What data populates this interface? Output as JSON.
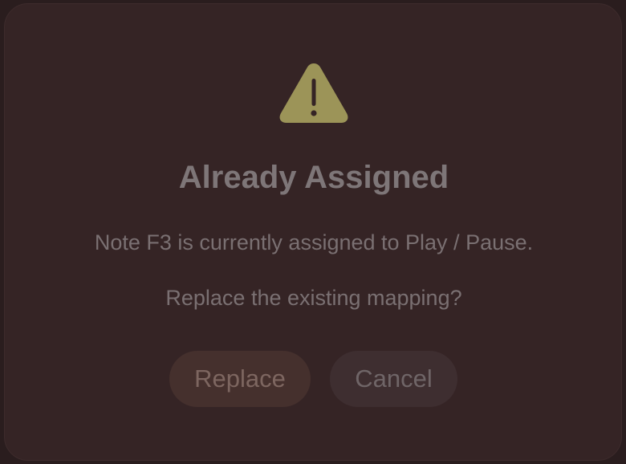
{
  "dialog": {
    "icon": "warning-triangle-icon",
    "title": "Already Assigned",
    "message": "Note F3 is currently assigned to Play / Pause.",
    "prompt": "Replace the existing mapping?",
    "buttons": {
      "replace_label": "Replace",
      "cancel_label": "Cancel"
    }
  },
  "colors": {
    "background": "#2a1d1e",
    "dialog_background": "#352425",
    "warning_icon": "#9c9458",
    "title_text": "#7e7678",
    "body_text": "#7a7072",
    "replace_button": "#45302d",
    "cancel_button": "#3e2e30"
  }
}
